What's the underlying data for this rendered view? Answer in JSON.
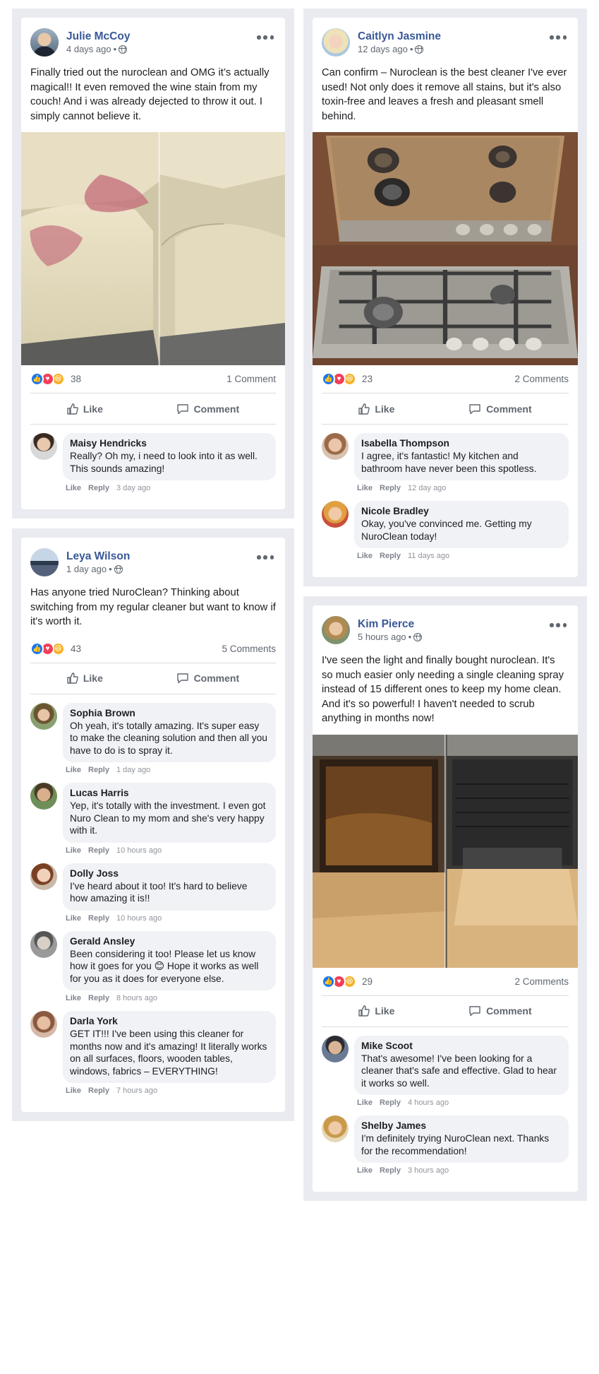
{
  "posts": {
    "julie": {
      "author": "Julie McCoy",
      "time": "4 days ago",
      "text": "Finally tried out the nuroclean and OMG it’s actually magical!! It even removed the wine stain from my couch! And i was already dejected to throw it out. I simply cannot believe it.",
      "reaction_count": "38",
      "comment_count": "1 Comment",
      "comments": [
        {
          "name": "Maisy Hendricks",
          "text": "Really? Oh my, i need to look into it as well. This sounds amazing!",
          "time": "3 day ago"
        }
      ]
    },
    "leya": {
      "author": "Leya Wilson",
      "time": "1 day ago",
      "text": "Has anyone tried NuroClean? Thinking about switching from my regular cleaner but want to know if it's worth it.",
      "reaction_count": "43",
      "comment_count": "5 Comments",
      "comments": [
        {
          "name": "Sophia Brown",
          "text": "Oh yeah, it's totally amazing. It's super easy to make the cleaning solution and then all you have to do is to spray it.",
          "time": "1 day ago"
        },
        {
          "name": "Lucas Harris",
          "text": "Yep, it's totally with the investment. I even got Nuro Clean to my mom and she's very happy with it.",
          "time": "10 hours ago"
        },
        {
          "name": "Dolly Joss",
          "text": "I've heard about it too! It's hard to believe how amazing it is!!",
          "time": "10 hours ago"
        },
        {
          "name": "Gerald Ansley",
          "text": "Been considering it too! Please let us know how it goes for you 😊 Hope it works as well for you as it does for everyone else.",
          "time": "8 hours ago"
        },
        {
          "name": "Darla York",
          "text": "GET IT!!! I've been using this cleaner for months now and it's amazing! It literally works on all surfaces, floors, wooden tables, windows, fabrics – EVERYTHING!",
          "time": "7 hours ago"
        }
      ]
    },
    "caitlyn": {
      "author": "Caitlyn Jasmine",
      "time": "12 days ago",
      "text": "Can confirm – Nuroclean is the best cleaner I've ever used! Not only does it remove all stains, but it's also toxin-free and leaves a fresh and pleasant smell behind.",
      "reaction_count": "23",
      "comment_count": "2 Comments",
      "comments": [
        {
          "name": "Isabella Thompson",
          "text": "I agree, it's fantastic! My kitchen and bathroom have never been this spotless.",
          "time": "12 day ago"
        },
        {
          "name": "Nicole Bradley",
          "text": "Okay, you've convinced me. Getting my NuroClean today!",
          "time": "11 days ago"
        }
      ]
    },
    "kim": {
      "author": "Kim Pierce",
      "time": "5 hours ago",
      "text": "I've seen the light and finally bought nuroclean. It's so much easier only needing a single cleaning spray instead of 15 different ones to keep my home clean. And it's so powerful! I haven't needed to scrub anything in months now!",
      "reaction_count": "29",
      "comment_count": "2 Comments",
      "comments": [
        {
          "name": "Mike Scoot",
          "text": "That's awesome! I've been looking for a cleaner that's safe and effective. Glad to hear it works so well.",
          "time": "4 hours ago"
        },
        {
          "name": "Shelby James",
          "text": "I'm definitely trying NuroClean next. Thanks for the recommendation!",
          "time": "3 hours ago"
        }
      ]
    }
  },
  "labels": {
    "like": "Like",
    "comment": "Comment",
    "reply": "Reply",
    "separator": " •"
  },
  "colors": {
    "author_blue": "#385898",
    "like_blue": "#1877f2",
    "love_red": "#f33e58",
    "haha_yellow": "#f7b125",
    "frame_gray": "#e9ebf0",
    "bubble_gray": "#f0f2f5"
  }
}
